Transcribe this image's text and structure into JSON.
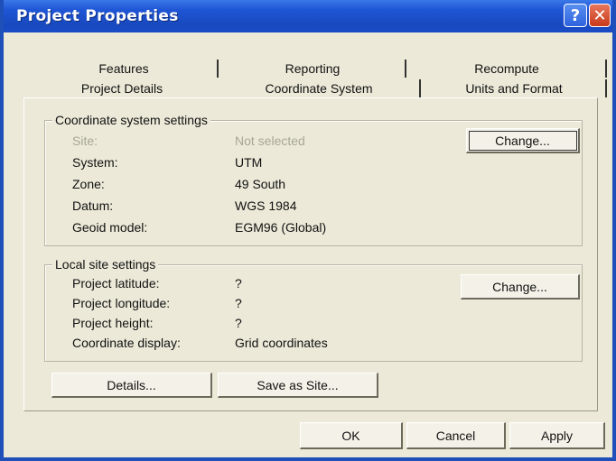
{
  "window": {
    "title": "Project Properties",
    "help_label": "?",
    "close_label": "✕"
  },
  "tabs": {
    "row1": [
      {
        "label": "Features"
      },
      {
        "label": "Reporting"
      },
      {
        "label": "Recompute"
      }
    ],
    "row2": [
      {
        "label": "Project Details"
      },
      {
        "label": "Coordinate System"
      },
      {
        "label": "Units and Format"
      }
    ],
    "active": "Coordinate System"
  },
  "coordinate_group": {
    "title": "Coordinate system settings",
    "rows": [
      {
        "label": "Site:",
        "value": "Not selected",
        "disabled": true
      },
      {
        "label": "System:",
        "value": "UTM"
      },
      {
        "label": "Zone:",
        "value": "49 South"
      },
      {
        "label": "Datum:",
        "value": "WGS 1984"
      },
      {
        "label": "Geoid model:",
        "value": "EGM96 (Global)"
      }
    ],
    "change_label": "Change..."
  },
  "local_group": {
    "title": "Local site settings",
    "rows": [
      {
        "label": "Project latitude:",
        "value": "?"
      },
      {
        "label": "Project longitude:",
        "value": "?"
      },
      {
        "label": "Project height:",
        "value": "?"
      },
      {
        "label": "Coordinate display:",
        "value": "Grid coordinates"
      }
    ],
    "change_label": "Change..."
  },
  "actions": {
    "details_label": "Details...",
    "save_site_label": "Save as Site..."
  },
  "footer": {
    "ok_label": "OK",
    "cancel_label": "Cancel",
    "apply_label": "Apply"
  },
  "colors": {
    "title_bar": "#1f56d6",
    "dialog_bg": "#ece9d8",
    "close_button": "#c93a1c",
    "disabled_text": "#a8a696"
  }
}
